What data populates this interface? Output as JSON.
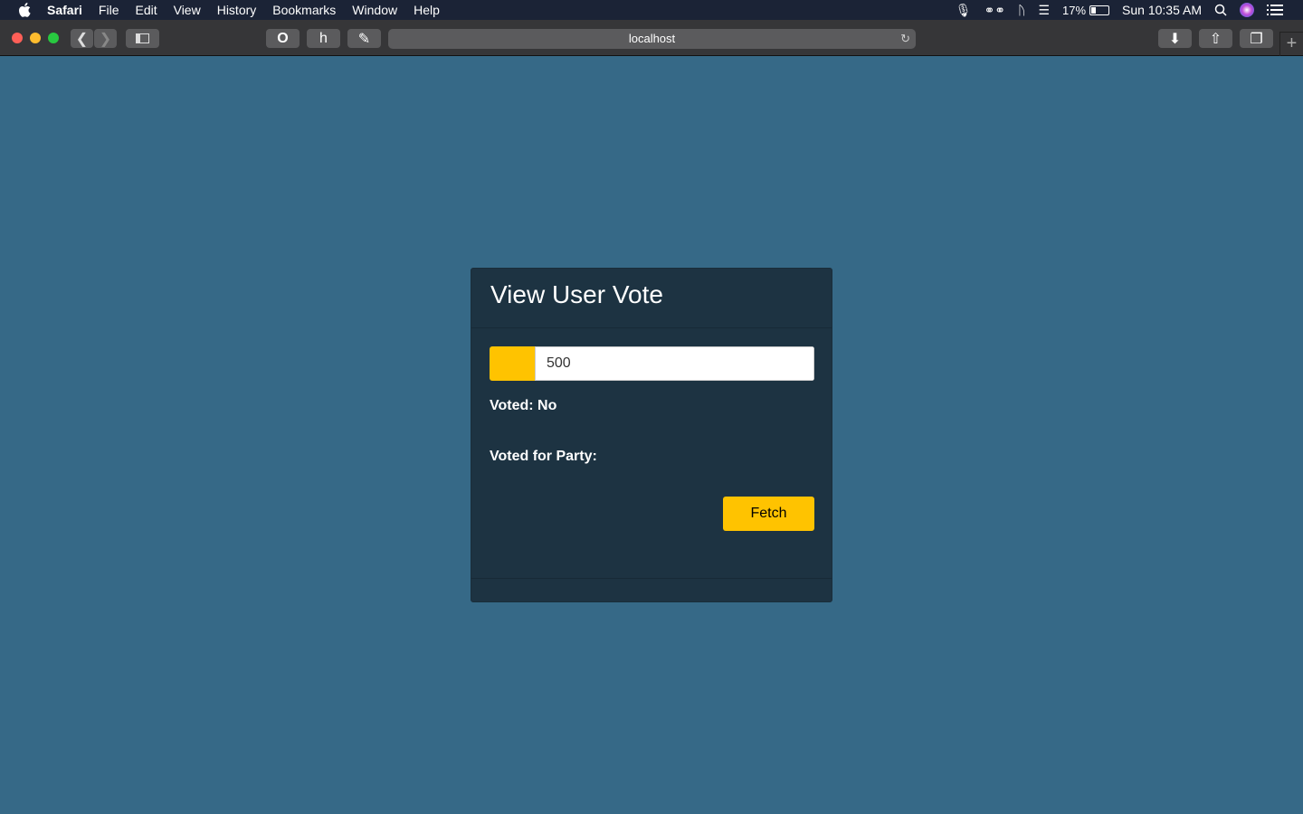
{
  "menubar": {
    "app": "Safari",
    "items": [
      "File",
      "Edit",
      "View",
      "History",
      "Bookmarks",
      "Window",
      "Help"
    ],
    "battery": "17%",
    "clock": "Sun 10:35 AM"
  },
  "browser": {
    "url": "localhost"
  },
  "card": {
    "title": "View User Vote",
    "input_value": "500",
    "voted_label": "Voted: No",
    "party_label": "Voted for Party:",
    "fetch_label": "Fetch"
  },
  "colors": {
    "page_bg": "#366987",
    "card_bg": "#1d3342",
    "accent": "#ffc300"
  }
}
